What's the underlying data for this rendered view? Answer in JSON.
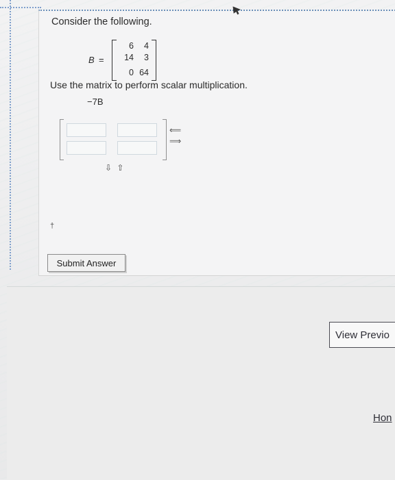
{
  "question": {
    "prompt": "Consider the following.",
    "matrix": {
      "name": "B",
      "equals": "=",
      "rows": [
        [
          "6",
          "4"
        ],
        [
          "14",
          "3"
        ],
        [
          "0",
          "64"
        ]
      ]
    },
    "instruction": "Use the matrix to perform scalar multiplication.",
    "expression": "−7B",
    "answer_cells": [
      [
        "",
        ""
      ],
      [
        "",
        ""
      ]
    ],
    "column_controls": {
      "remove": "⟸",
      "add": "⟹"
    },
    "row_controls": {
      "add": "⇩",
      "remove": "⇧"
    },
    "footnote_mark": "†",
    "submit_label": "Submit Answer"
  },
  "nav": {
    "view_previous_label": "View Previo",
    "home_label": "Hon"
  },
  "colors": {
    "panel_border": "#6a8fb8",
    "text": "#2a2a2a",
    "button_border": "#4a4a52"
  },
  "icons": {
    "cursor": "mouse-pointer-icon"
  }
}
